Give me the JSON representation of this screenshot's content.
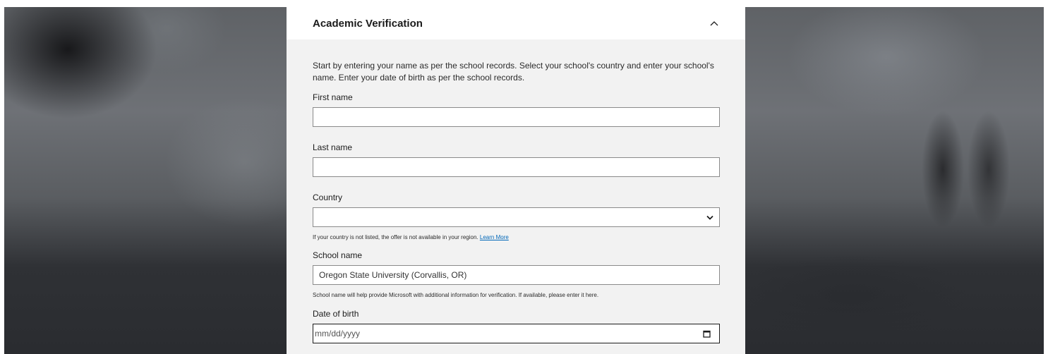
{
  "card": {
    "title": "Academic Verification"
  },
  "intro": "Start by entering your name as per the school records. Select your school's country and enter your school's name. Enter your date of birth as per the school records.",
  "fields": {
    "first_name": {
      "label": "First name",
      "value": ""
    },
    "last_name": {
      "label": "Last name",
      "value": ""
    },
    "country": {
      "label": "Country",
      "value": "",
      "help_text": "If your country is not listed, the offer is not available in your region.",
      "help_link": "Learn More"
    },
    "school_name": {
      "label": "School name",
      "value": "Oregon State University (Corvallis, OR)",
      "help_text": "School name will help provide Microsoft with additional information for verification. If available, please enter it here."
    },
    "date_of_birth": {
      "label": "Date of birth",
      "placeholder": "mm/dd/yyyy"
    }
  },
  "colors": {
    "link": "#0067b8",
    "panel": "#f2f2f2",
    "header": "#ffffff"
  },
  "icons": {
    "collapse": "chevron-up-icon",
    "select": "chevron-down-icon",
    "date": "calendar-icon"
  }
}
